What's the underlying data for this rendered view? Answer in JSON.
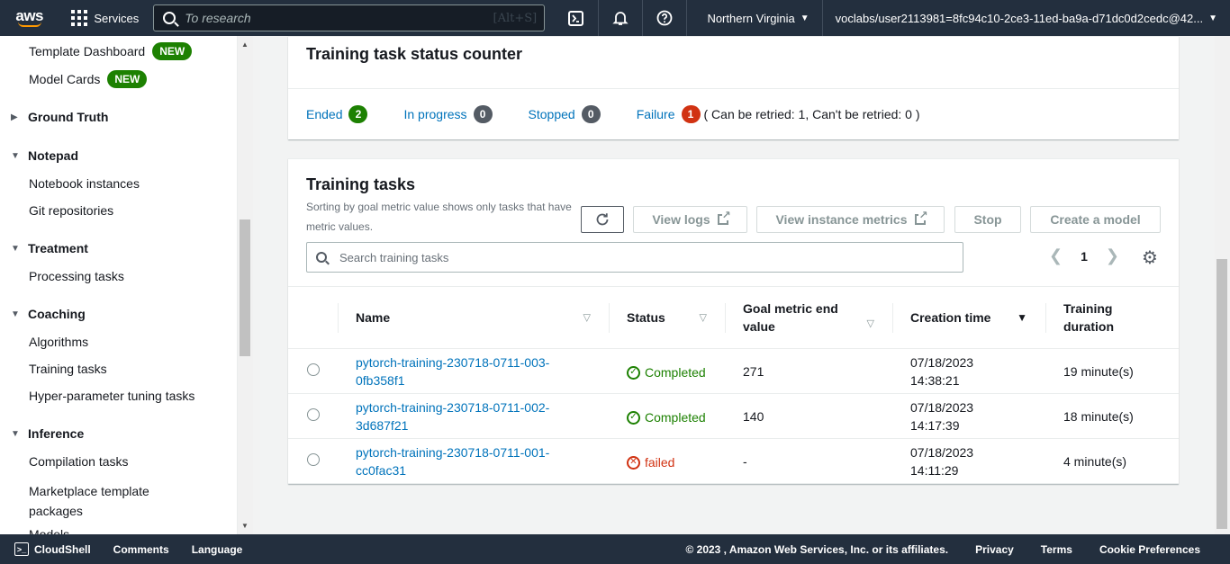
{
  "topnav": {
    "logo_text": "aws",
    "services_label": "Services",
    "search_placeholder": "To research",
    "search_shortcut": "[Alt+S]",
    "region": "Northern Virginia",
    "user": "voclabs/user2113981=8fc94c10-2ce3-11ed-ba9a-d71dc0d2cedc@42...",
    "icons": [
      "cloudshell-icon",
      "bell-icon",
      "help-icon"
    ]
  },
  "sidebar": {
    "items": [
      {
        "label": "Template Dashboard",
        "badge": "NEW"
      },
      {
        "label": "Model Cards",
        "badge": "NEW"
      }
    ],
    "ground_truth": "Ground Truth",
    "notepad": "Notepad",
    "notebook_instances": "Notebook instances",
    "git_repositories": "Git repositories",
    "treatment": "Treatment",
    "processing_tasks": "Processing tasks",
    "coaching": "Coaching",
    "algorithms": "Algorithms",
    "training_tasks": "Training tasks",
    "hpt_tasks": "Hyper-parameter tuning tasks",
    "inference": "Inference",
    "compilation_tasks": "Compilation tasks",
    "marketplace_templates": "Marketplace template packages",
    "models_partial": "Models"
  },
  "status_counter": {
    "title": "Training task status counter",
    "ended_label": "Ended",
    "ended_count": "2",
    "ended_color": "#1d8102",
    "inprogress_label": "In progress",
    "inprogress_count": "0",
    "stopped_label": "Stopped",
    "stopped_count": "0",
    "neutral_color": "#545b64",
    "failure_label": "Failure",
    "failure_count": "1",
    "failure_color": "#d13212",
    "failure_note": "( Can be retried: 1, Can't be retried: 0 )"
  },
  "training_tasks": {
    "title": "Training tasks",
    "description": "Sorting by goal metric value shows only tasks that have metric values.",
    "buttons": {
      "view_logs": "View logs",
      "view_instance_metrics": "View instance metrics",
      "stop": "Stop",
      "create_model": "Create a model"
    },
    "search_placeholder": "Search training tasks",
    "page": "1",
    "columns": {
      "name": "Name",
      "status": "Status",
      "goal_metric": "Goal metric end value",
      "creation_time": "Creation time",
      "training_duration": "Training duration"
    },
    "rows": [
      {
        "name": "pytorch-training-230718-0711-003-0fb358f1",
        "status": "Completed",
        "metric": "271",
        "created": "07/18/2023 14:38:21",
        "duration": "19 minute(s)"
      },
      {
        "name": "pytorch-training-230718-0711-002-3d687f21",
        "status": "Completed",
        "metric": "140",
        "created": "07/18/2023 14:17:39",
        "duration": "18 minute(s)"
      },
      {
        "name": "pytorch-training-230718-0711-001-cc0fac31",
        "status": "failed",
        "metric": "-",
        "created": "07/18/2023 14:11:29",
        "duration": "4 minute(s)"
      }
    ]
  },
  "footer": {
    "cloudshell": "CloudShell",
    "comments": "Comments",
    "language": "Language",
    "copyright": "© 2023 , Amazon Web Services, Inc. or its affiliates.",
    "privacy": "Privacy",
    "terms": "Terms",
    "cookie_prefs": "Cookie Preferences"
  }
}
